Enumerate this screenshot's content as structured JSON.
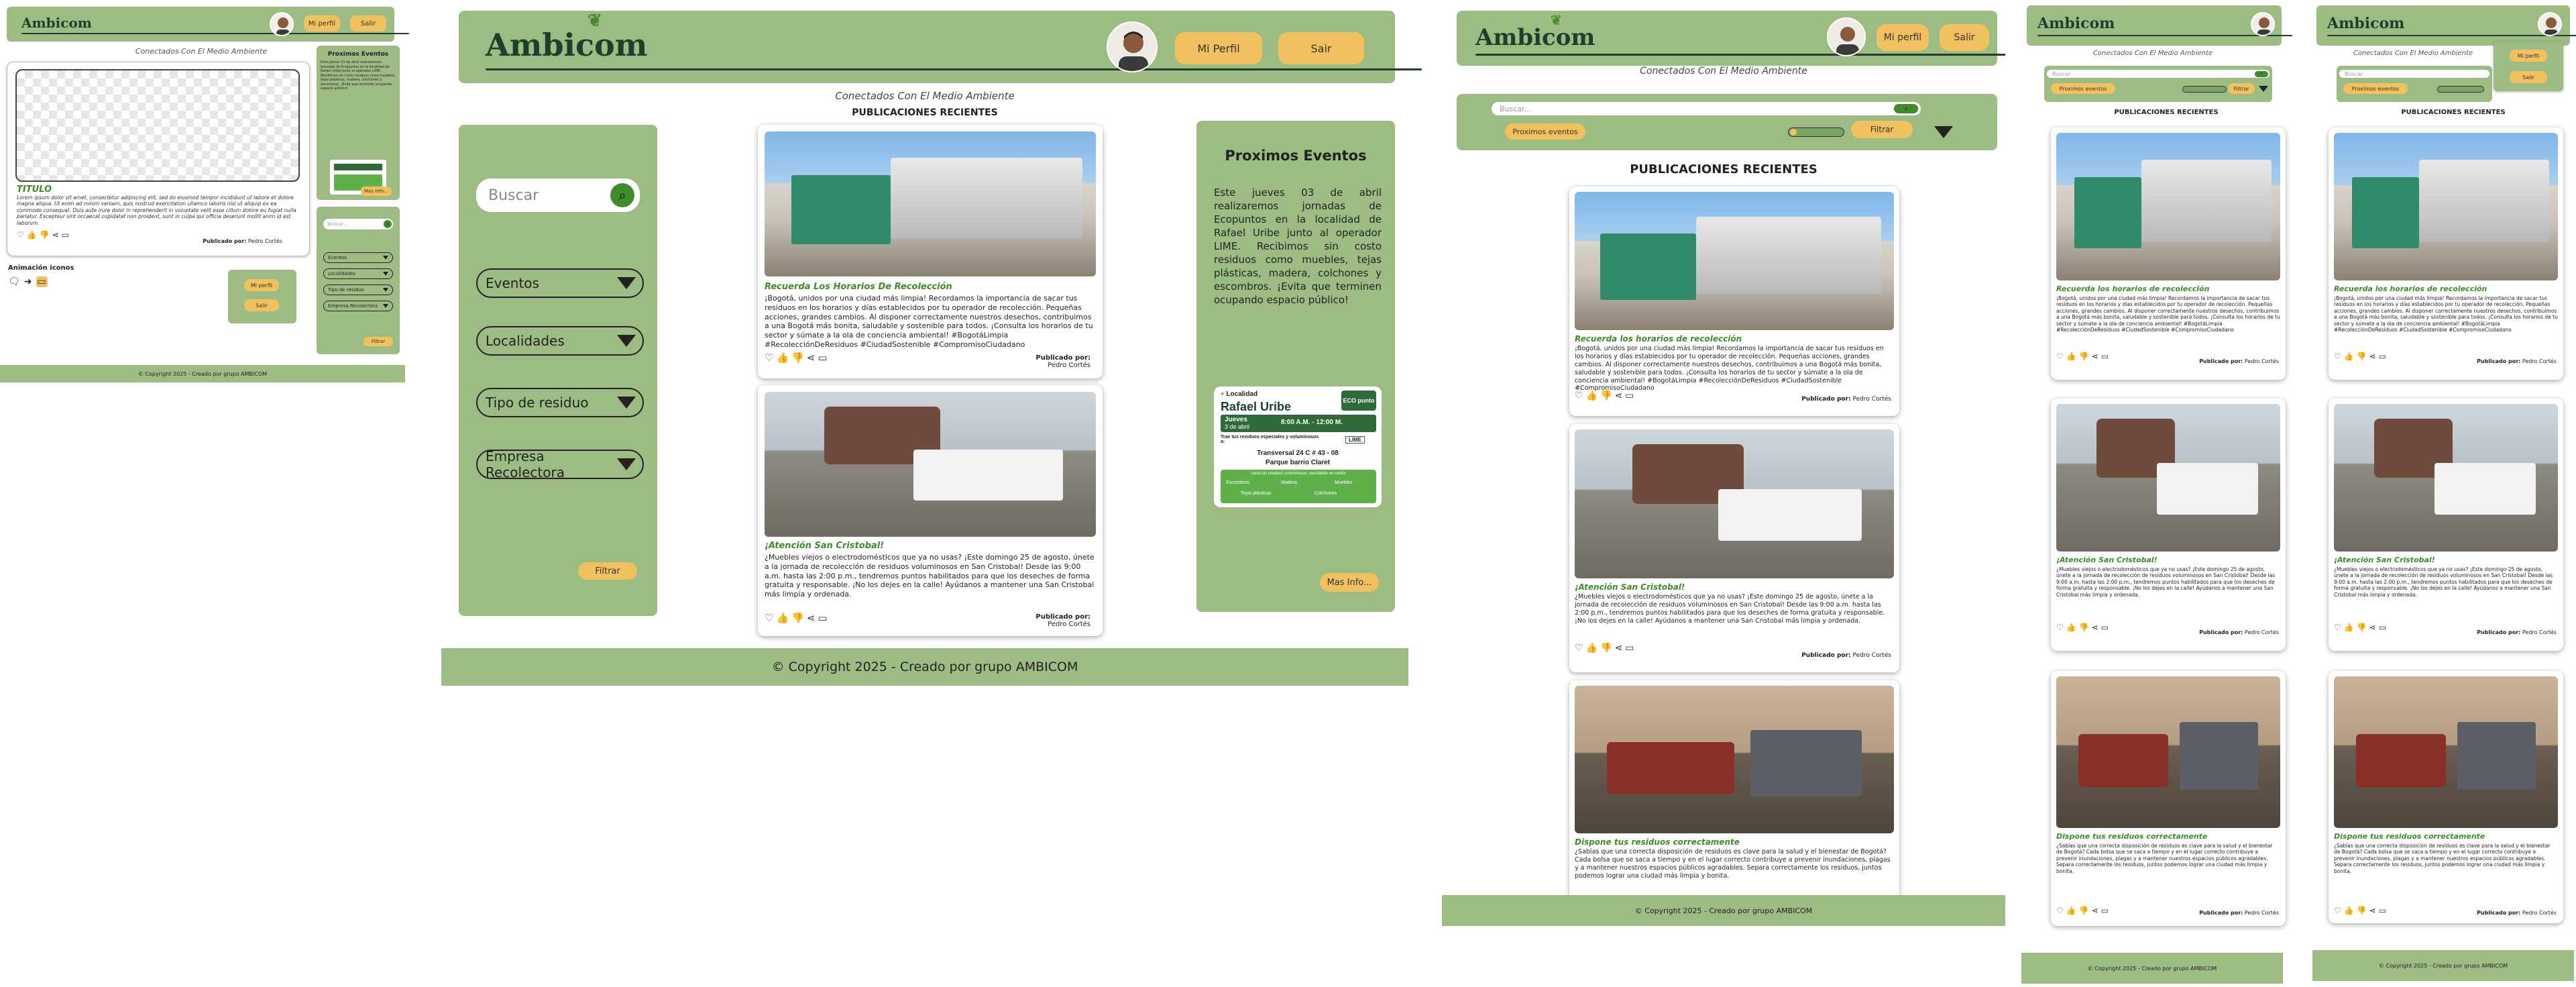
{
  "brand": {
    "name": "Ambicom",
    "slogan": "Conectados Con El Medio Ambiente",
    "accent": "#9dbc84",
    "button_color": "#f0c15e",
    "title_green": "#3f8a2a"
  },
  "header": {
    "profile_label": "Mi Perfil",
    "logout_label": "Sair"
  },
  "small_header": {
    "profile_label": "Mi perfil",
    "logout_label": "Salir"
  },
  "feed": {
    "heading": "PUBLICACIONES RECIENTES"
  },
  "filters": {
    "search_placeholder": "Buscar",
    "small_search_placeholder": "Buscar...",
    "events": "Eventos",
    "localities": "Localidades",
    "waste_type": "Tipo de residuo",
    "company": "Empresa Recolectora",
    "filter_button": "Filtrar",
    "events_chip": "Proximos eventos"
  },
  "events_panel": {
    "title": "Proximos Eventos",
    "body": "Este jueves 03 de abril realizaremos jornadas de Ecopuntos en la localidad de Rafael Uribe junto al operador LIME. Recibimos sin costo residuos como muebles, tejas plásticas, madera, colchones y escombros. ¡Evita que terminen ocupando espacio público!",
    "more_button": "Mas Info...",
    "flyer": {
      "locality_label": "Localidad",
      "locality": "Rafael Uribe",
      "day": "Jueves",
      "date": "3 de abril",
      "hours": "8:00 A.M. - 12:00 M.",
      "badge": "ECO punto",
      "note": "Trae tus residuos especiales y voluminosos a:",
      "operator": "LIME",
      "address": "Transversal 24 C # 43 - 08",
      "place": "Parque barrio Claret",
      "accepted_title": "Llevá tus residuos voluminosos, reciclables en cartón",
      "accepted": [
        "Escombros",
        "Madera",
        "Muebles",
        "Tejas plásticas",
        "Colchones"
      ]
    }
  },
  "posts": [
    {
      "title": "Recuerda Los Horarios De Recolección",
      "title_alt": "Recuerda los horarios de recolección",
      "image": "garbage-truck-photo",
      "text": "¡Bogotá, unidos por una ciudad más limpia! Recordamos la importancia de sacar tus residuos en los horarios y días establecidos por tu operador de recolección. Pequeñas acciones, grandes cambios. Al disponer correctamente nuestros desechos, contribuimos a una Bogotá más bonita, saludable y sostenible para todos. ¡Consulta los horarios de tu sector y súmate a la ola de conciencia ambiental! #BogotáLimpia #RecolecciónDeResiduos #CiudadSostenible #CompromisoCiudadano",
      "by_label": "Publicado por:",
      "author": "Pedro Cortés"
    },
    {
      "title": "¡Atención San Cristobal!",
      "title_alt": "¡Atención San Cristobal!",
      "image": "furniture-loading-photo",
      "text": "¿Muebles viejos o electrodomésticos que ya no usas? ¡Este domingo 25 de agosto, únete a la jornada de recolección de residuos voluminosos en San Cristobal! Desde las 9:00 a.m. hasta las 2:00 p.m., tendremos puntos habilitados para que los deseches de forma gratuita y responsable. ¡No los dejes en la calle! Ayúdanos a mantener una San Cristobal más limpia y ordenada.",
      "by_label": "Publicado por:",
      "author": "Pedro Cortés"
    },
    {
      "title": "Dispone tus residuos correctamente",
      "title_alt": "Dispone tus residuos correctamente",
      "image": "discarded-furniture-photo",
      "text": "¿Sabías que una correcta disposición de residuos es clave para la salud y el bienestar de Bogotá? Cada bolsa que se saca a tiempo y en el lugar correcto contribuye a prevenir inundaciones, plagas y a mantener nuestros espacios públicos agradables. Separa correctamente los residuos, juntos podemos lograr una ciudad más limpia y bonita.",
      "by_label": "Publicado por:",
      "author": "Pedro Cortés"
    }
  ],
  "mockup": {
    "placeholder_title": "TITULO",
    "placeholder_text": "Lorem ipsum dolor sit amet, consectetur adipiscing elit, sed do eiusmod tempor incididunt ut labore et dolore magna aliqua. Ut enim ad minim veniam, quis nostrud exercitation ullamco laboris nisi ut aliquip ex ea commodo consequat. Duis aute irure dolor in reprehenderit in voluptate velit esse cillum dolore eu fugiat nulla pariatur. Excepteur sint occaecat cupidatat non proident, sunt in culpa qui officia deserunt mollit anim id est laborum.",
    "by_label": "Publicado por:",
    "author": "Pedro Cortés",
    "animation_label": "Animación iconos"
  },
  "footer": {
    "text": "© Copyright 2025 - Creado por grupo AMBICOM",
    "small_text": "© Copyright 2025 - Creado por grupo AMBICOM"
  },
  "icons": [
    "heart-icon",
    "thumbs-up-icon",
    "thumbs-down-icon",
    "share-icon",
    "comment-icon",
    "search-icon",
    "chevron-down-icon"
  ]
}
